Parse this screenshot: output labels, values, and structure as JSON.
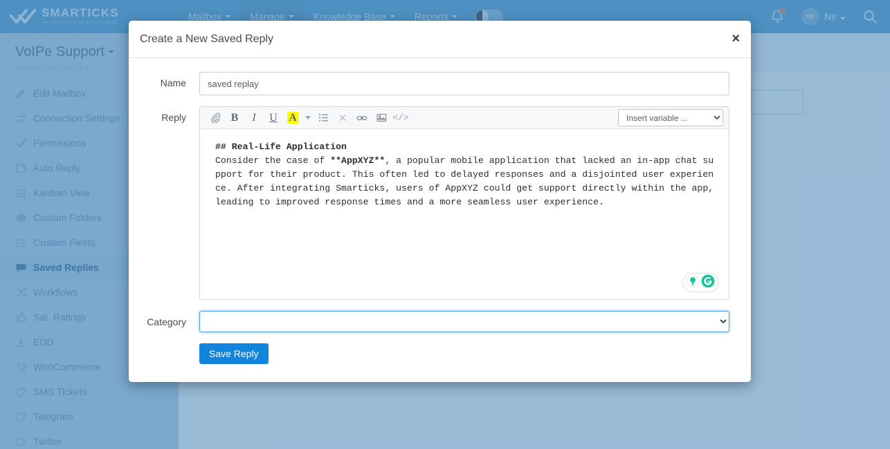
{
  "brand": {
    "name": "SMARTICKS",
    "tagline": "MAKING YOU AVAILABLE FOR SUCCESS",
    "logo_icon": "double-check-icon"
  },
  "topnav": {
    "items": [
      {
        "label": "Mailbox",
        "has_caret": true,
        "active": false
      },
      {
        "label": "Manage",
        "has_caret": true,
        "active": true
      },
      {
        "label": "Knowledge Base",
        "has_caret": true,
        "active": false
      },
      {
        "label": "Reports",
        "has_caret": true,
        "active": false
      }
    ],
    "theme_toggle": {
      "name": "dark-mode-toggle",
      "state": "off"
    },
    "notifications_icon": "bell-icon",
    "has_notification_dot": true,
    "user": {
      "initials": "NK",
      "name": "Nir"
    },
    "search_icon": "search-icon"
  },
  "sidebar": {
    "mailbox_name": "VoIPe Support",
    "mailbox_email": "support@voipe.co.il",
    "items": [
      {
        "label": "Edit Mailbox",
        "icon": "pencil-icon",
        "active": false
      },
      {
        "label": "Connection Settings",
        "icon": "exchange-arrows-icon",
        "active": false
      },
      {
        "label": "Permissions",
        "icon": "check-icon",
        "active": false
      },
      {
        "label": "Auto Reply",
        "icon": "reply-document-icon",
        "active": false
      },
      {
        "label": "Kanban View",
        "icon": "grid-dots-icon",
        "active": false
      },
      {
        "label": "Custom Folders",
        "icon": "folder-icon",
        "active": false
      },
      {
        "label": "Custom Fields",
        "icon": "list-icon",
        "active": false
      },
      {
        "label": "Saved Replies",
        "icon": "comment-icon",
        "active": true
      },
      {
        "label": "Workflows",
        "icon": "shuffle-icon",
        "active": false
      },
      {
        "label": "Sat. Ratings",
        "icon": "thumbs-up-icon",
        "active": false
      },
      {
        "label": "EDD",
        "icon": "download-icon",
        "active": false
      },
      {
        "label": "WooCommerce",
        "icon": "cart-icon",
        "active": false
      },
      {
        "label": "SMS Tickets",
        "icon": "tag-icon",
        "active": false
      },
      {
        "label": "Telegram",
        "icon": "tag-icon",
        "active": false
      },
      {
        "label": "Twitter",
        "icon": "tag-icon",
        "active": false
      }
    ]
  },
  "modal": {
    "title": "Create a New Saved Reply",
    "close_label": "×",
    "name_field": {
      "label": "Name",
      "value": "saved replay",
      "placeholder": ""
    },
    "reply_field": {
      "label": "Reply",
      "toolbar": [
        {
          "name": "attach-icon",
          "glyph": "📎",
          "kind": "attach"
        },
        {
          "name": "bold-icon",
          "glyph": "B",
          "kind": "bold"
        },
        {
          "name": "italic-icon",
          "glyph": "I",
          "kind": "italic"
        },
        {
          "name": "underline-icon",
          "glyph": "U",
          "kind": "underline"
        },
        {
          "name": "text-color-icon",
          "glyph": "A",
          "kind": "color"
        },
        {
          "name": "chevron-down-icon",
          "glyph": "",
          "kind": "caret"
        },
        {
          "name": "bullet-list-icon",
          "glyph": "",
          "kind": "list"
        },
        {
          "name": "clear-format-icon",
          "glyph": "✕",
          "kind": "clear"
        },
        {
          "name": "link-icon",
          "glyph": "",
          "kind": "link"
        },
        {
          "name": "image-icon",
          "glyph": "",
          "kind": "image"
        },
        {
          "name": "code-icon",
          "glyph": "</>",
          "kind": "code"
        }
      ],
      "insert_variable": {
        "selected": "Insert variable ...",
        "options": [
          "Insert variable ..."
        ]
      },
      "content_heading": "## Real-Life Application",
      "content_body": "Consider the case of **AppXYZ**, a popular mobile application that lacked an in-app chat support for their product. This often led to delayed responses and a disjointed user experience. After integrating Smarticks, users of AppXYZ could get support directly within the app, leading to improved response times and a more seamless user experience.",
      "grammarly_badge": {
        "bulb_icon": "lightbulb-icon",
        "logo_icon": "grammarly-g-icon"
      }
    },
    "category_field": {
      "label": "Category",
      "selected": "",
      "options": [
        ""
      ]
    },
    "save_button": "Save Reply"
  },
  "colors": {
    "nav_blue": "#3c8dc5",
    "sidebar_blue": "#a6c6e0",
    "accent_blue": "#1184dd",
    "highlight_yellow": "#ffff00",
    "grammarly_green": "#15c39a",
    "overlay": "rgba(92,146,191,0.58)"
  }
}
